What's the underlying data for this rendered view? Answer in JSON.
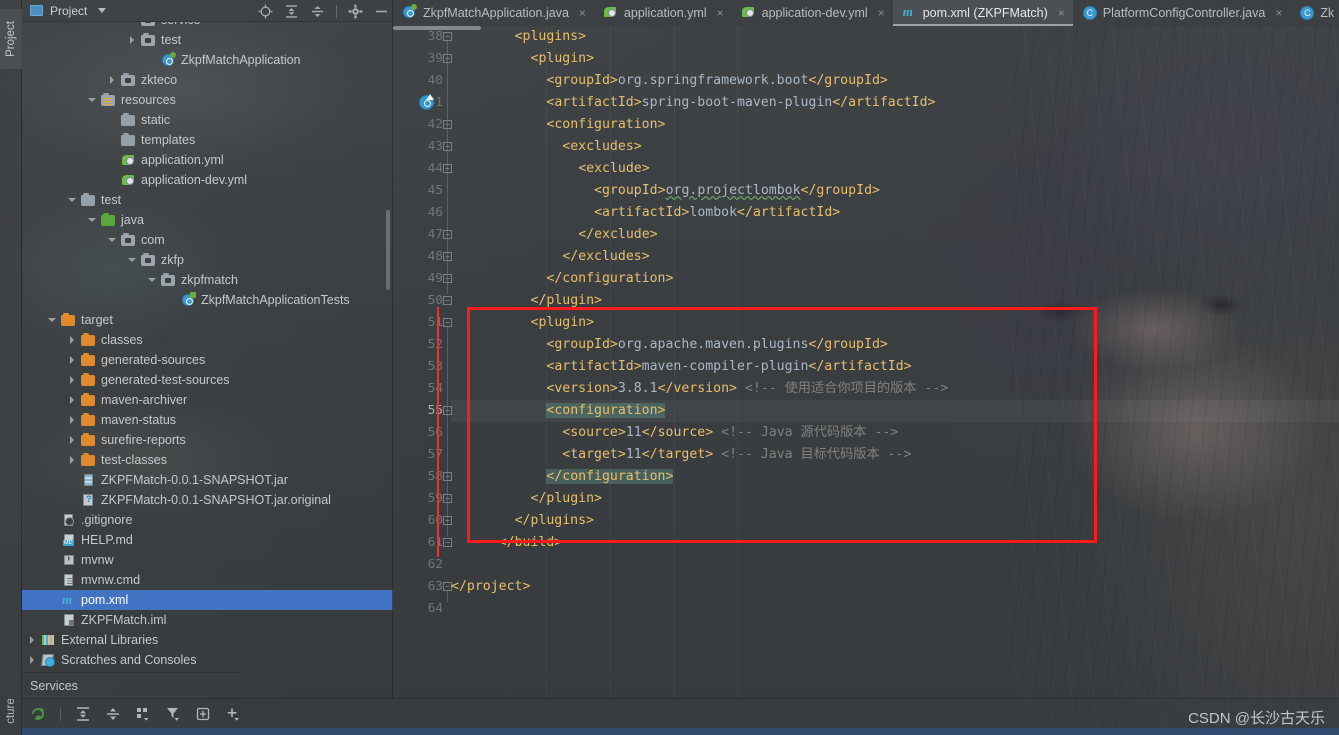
{
  "window": {
    "left_rail": {
      "project_tab": "Project",
      "structure_tab": "cture"
    }
  },
  "project_panel": {
    "title": "Project",
    "icons": [
      "locate-icon",
      "expand-all-icon",
      "collapse-all-icon",
      "settings-gear-icon",
      "minimize-icon"
    ],
    "tree": [
      {
        "label": "service",
        "indent": 5,
        "arrow": "none",
        "icon": "package-folder",
        "sel": false,
        "partial": true
      },
      {
        "label": "test",
        "indent": 5,
        "arrow": "right",
        "icon": "package-folder",
        "sel": false
      },
      {
        "label": "ZkpfMatchApplication",
        "indent": 6,
        "arrow": "none",
        "icon": "spring-class",
        "sel": false
      },
      {
        "label": "zkteco",
        "indent": 4,
        "arrow": "right",
        "icon": "package-folder",
        "sel": false
      },
      {
        "label": "resources",
        "indent": 3,
        "arrow": "down",
        "icon": "resources-folder",
        "sel": false
      },
      {
        "label": "static",
        "indent": 4,
        "arrow": "none",
        "icon": "folder-generic",
        "sel": false
      },
      {
        "label": "templates",
        "indent": 4,
        "arrow": "none",
        "icon": "folder-generic",
        "sel": false
      },
      {
        "label": "application.yml",
        "indent": 4,
        "arrow": "none",
        "icon": "yml-file",
        "sel": false
      },
      {
        "label": "application-dev.yml",
        "indent": 4,
        "arrow": "none",
        "icon": "yml-file",
        "sel": false
      },
      {
        "label": "test",
        "indent": 2,
        "arrow": "down",
        "icon": "folder-generic",
        "sel": false
      },
      {
        "label": "java",
        "indent": 3,
        "arrow": "down",
        "icon": "folder-green",
        "sel": false
      },
      {
        "label": "com",
        "indent": 4,
        "arrow": "down",
        "icon": "package-folder",
        "sel": false
      },
      {
        "label": "zkfp",
        "indent": 5,
        "arrow": "down",
        "icon": "package-folder",
        "sel": false
      },
      {
        "label": "zkpfmatch",
        "indent": 6,
        "arrow": "down",
        "icon": "package-folder",
        "sel": false
      },
      {
        "label": "ZkpfMatchApplicationTests",
        "indent": 7,
        "arrow": "none",
        "icon": "test-class",
        "sel": false
      },
      {
        "label": "target",
        "indent": 1,
        "arrow": "down",
        "icon": "folder-orange",
        "sel": false
      },
      {
        "label": "classes",
        "indent": 2,
        "arrow": "right",
        "icon": "folder-orange",
        "sel": false
      },
      {
        "label": "generated-sources",
        "indent": 2,
        "arrow": "right",
        "icon": "folder-orange",
        "sel": false
      },
      {
        "label": "generated-test-sources",
        "indent": 2,
        "arrow": "right",
        "icon": "folder-orange",
        "sel": false
      },
      {
        "label": "maven-archiver",
        "indent": 2,
        "arrow": "right",
        "icon": "folder-orange",
        "sel": false
      },
      {
        "label": "maven-status",
        "indent": 2,
        "arrow": "right",
        "icon": "folder-orange",
        "sel": false
      },
      {
        "label": "surefire-reports",
        "indent": 2,
        "arrow": "right",
        "icon": "folder-orange",
        "sel": false
      },
      {
        "label": "test-classes",
        "indent": 2,
        "arrow": "right",
        "icon": "folder-orange",
        "sel": false
      },
      {
        "label": "ZKPFMatch-0.0.1-SNAPSHOT.jar",
        "indent": 2,
        "arrow": "none",
        "icon": "jar-file",
        "sel": false
      },
      {
        "label": "ZKPFMatch-0.0.1-SNAPSHOT.jar.original",
        "indent": 2,
        "arrow": "none",
        "icon": "jar-unknown-file",
        "sel": false
      },
      {
        "label": ".gitignore",
        "indent": 1,
        "arrow": "none",
        "icon": "gitignore-file",
        "sel": false
      },
      {
        "label": "HELP.md",
        "indent": 1,
        "arrow": "none",
        "icon": "markdown-file",
        "sel": false
      },
      {
        "label": "mvnw",
        "indent": 1,
        "arrow": "none",
        "icon": "shell-file",
        "sel": false
      },
      {
        "label": "mvnw.cmd",
        "indent": 1,
        "arrow": "none",
        "icon": "text-file",
        "sel": false
      },
      {
        "label": "pom.xml",
        "indent": 1,
        "arrow": "none",
        "icon": "maven-file",
        "sel": true
      },
      {
        "label": "ZKPFMatch.iml",
        "indent": 1,
        "arrow": "none",
        "icon": "iml-file",
        "sel": false
      },
      {
        "label": "External Libraries",
        "indent": 0,
        "arrow": "right",
        "icon": "external-libraries",
        "sel": false
      },
      {
        "label": "Scratches and Consoles",
        "indent": 0,
        "arrow": "right",
        "icon": "scratches",
        "sel": false
      }
    ]
  },
  "services_bar": {
    "label": "Services"
  },
  "tabs": [
    {
      "label": "ZkpfMatchApplication.java",
      "icon": "spring-class-icon",
      "active": false,
      "closable": true
    },
    {
      "label": "application.yml",
      "icon": "yml-icon",
      "active": false,
      "closable": true
    },
    {
      "label": "application-dev.yml",
      "icon": "yml-icon",
      "active": false,
      "closable": true
    },
    {
      "label": "pom.xml (ZKPFMatch)",
      "icon": "maven-icon",
      "active": true,
      "closable": true
    },
    {
      "label": "PlatformConfigController.java",
      "icon": "java-class-icon",
      "active": false,
      "closable": true
    },
    {
      "label": "Zk",
      "icon": "java-class-icon",
      "active": false,
      "closable": false
    }
  ],
  "editor": {
    "file": "pom.xml",
    "first_line": 38,
    "last_line": 64,
    "lines": [
      {
        "n": 38,
        "indent": 8,
        "parts": [
          {
            "t": "tag",
            "s": "<plugins>"
          }
        ],
        "fold": "open"
      },
      {
        "n": 39,
        "indent": 10,
        "parts": [
          {
            "t": "tag",
            "s": "<plugin>"
          }
        ],
        "fold": "open"
      },
      {
        "n": 40,
        "indent": 12,
        "parts": [
          {
            "t": "tag",
            "s": "<groupId>"
          },
          {
            "t": "txt",
            "s": "org.springframework.boot"
          },
          {
            "t": "tag",
            "s": "</groupId>"
          }
        ]
      },
      {
        "n": 41,
        "indent": 12,
        "parts": [
          {
            "t": "tag",
            "s": "<artifactId>"
          },
          {
            "t": "txt",
            "s": "spring-boot-maven-plugin"
          },
          {
            "t": "tag",
            "s": "</artifactId>"
          }
        ],
        "gutter_icon": "run-spring-icon"
      },
      {
        "n": 42,
        "indent": 12,
        "parts": [
          {
            "t": "tag",
            "s": "<configuration>"
          }
        ],
        "fold": "open"
      },
      {
        "n": 43,
        "indent": 14,
        "parts": [
          {
            "t": "tag",
            "s": "<excludes>"
          }
        ],
        "fold": "open"
      },
      {
        "n": 44,
        "indent": 16,
        "parts": [
          {
            "t": "tag",
            "s": "<exclude>"
          }
        ],
        "fold": "open"
      },
      {
        "n": 45,
        "indent": 18,
        "parts": [
          {
            "t": "tag",
            "s": "<groupId>"
          },
          {
            "t": "spell",
            "s": "org.projectlombok"
          },
          {
            "t": "tag",
            "s": "</groupId>"
          }
        ]
      },
      {
        "n": 46,
        "indent": 18,
        "parts": [
          {
            "t": "tag",
            "s": "<artifactId>"
          },
          {
            "t": "txt",
            "s": "lombok"
          },
          {
            "t": "tag",
            "s": "</artifactId>"
          }
        ]
      },
      {
        "n": 47,
        "indent": 16,
        "parts": [
          {
            "t": "tag",
            "s": "</exclude>"
          }
        ],
        "fold": "close"
      },
      {
        "n": 48,
        "indent": 14,
        "parts": [
          {
            "t": "tag",
            "s": "</excludes>"
          }
        ],
        "fold": "close"
      },
      {
        "n": 49,
        "indent": 12,
        "parts": [
          {
            "t": "tag",
            "s": "</configuration>"
          }
        ],
        "fold": "close"
      },
      {
        "n": 50,
        "indent": 10,
        "parts": [
          {
            "t": "tag",
            "s": "</plugin>"
          }
        ],
        "fold": "close"
      },
      {
        "n": 51,
        "indent": 10,
        "parts": [
          {
            "t": "tag",
            "s": "<plugin>"
          }
        ],
        "fold": "open"
      },
      {
        "n": 52,
        "indent": 12,
        "parts": [
          {
            "t": "tag",
            "s": "<groupId>"
          },
          {
            "t": "txt",
            "s": "org.apache.maven.plugins"
          },
          {
            "t": "tag",
            "s": "</groupId>"
          }
        ]
      },
      {
        "n": 53,
        "indent": 12,
        "parts": [
          {
            "t": "tag",
            "s": "<artifactId>"
          },
          {
            "t": "txt",
            "s": "maven-compiler-plugin"
          },
          {
            "t": "tag",
            "s": "</artifactId>"
          }
        ]
      },
      {
        "n": 54,
        "indent": 12,
        "parts": [
          {
            "t": "tag",
            "s": "<version>"
          },
          {
            "t": "txt",
            "s": "3.8.1"
          },
          {
            "t": "tag",
            "s": "</version>"
          },
          {
            "t": "cmt",
            "s": " <!-- 使用适合你项目的版本 -->"
          }
        ]
      },
      {
        "n": 55,
        "indent": 12,
        "parts": [
          {
            "t": "hl",
            "s": "<configuration>"
          }
        ],
        "fold": "open",
        "current": true
      },
      {
        "n": 56,
        "indent": 14,
        "parts": [
          {
            "t": "tag",
            "s": "<source>"
          },
          {
            "t": "txt",
            "s": "11"
          },
          {
            "t": "tag",
            "s": "</source>"
          },
          {
            "t": "cmt",
            "s": " <!-- Java 源代码版本 -->"
          }
        ]
      },
      {
        "n": 57,
        "indent": 14,
        "parts": [
          {
            "t": "tag",
            "s": "<target>"
          },
          {
            "t": "txt",
            "s": "11"
          },
          {
            "t": "tag",
            "s": "</target>"
          },
          {
            "t": "cmt",
            "s": " <!-- Java 目标代码版本 -->"
          }
        ]
      },
      {
        "n": 58,
        "indent": 12,
        "parts": [
          {
            "t": "hl",
            "s": "</configuration>"
          }
        ],
        "fold": "close"
      },
      {
        "n": 59,
        "indent": 10,
        "parts": [
          {
            "t": "tag",
            "s": "</plugin>"
          }
        ],
        "fold": "close"
      },
      {
        "n": 60,
        "indent": 8,
        "parts": [
          {
            "t": "tag",
            "s": "</plugins>"
          }
        ],
        "fold": "close"
      },
      {
        "n": 61,
        "indent": 6,
        "parts": [
          {
            "t": "tag",
            "s": "</build>"
          }
        ],
        "fold": "close"
      },
      {
        "n": 62,
        "indent": 0,
        "parts": []
      },
      {
        "n": 63,
        "indent": 0,
        "parts": [
          {
            "t": "tag",
            "s": "</project>"
          }
        ],
        "fold": "close"
      },
      {
        "n": 64,
        "indent": 0,
        "parts": []
      }
    ]
  },
  "annotation": {
    "shape": "rectangle",
    "color": "#fb1b1b"
  },
  "watermark": {
    "text": "CSDN @长沙古天乐"
  },
  "bottom_toolbar": {
    "icons": [
      "rerun-icon",
      "expand-all-icon",
      "collapse-all-icon",
      "group-by-icon",
      "filter-icon",
      "layout-icon",
      "add-icon"
    ]
  },
  "colors": {
    "accent_blue": "#4272c4",
    "annotation_red": "#fb1b1b",
    "tag_orange": "#e8bf6a",
    "value_text": "#a9b7c6",
    "comment_gray": "#808080",
    "highlight_green": "#5e9182"
  }
}
